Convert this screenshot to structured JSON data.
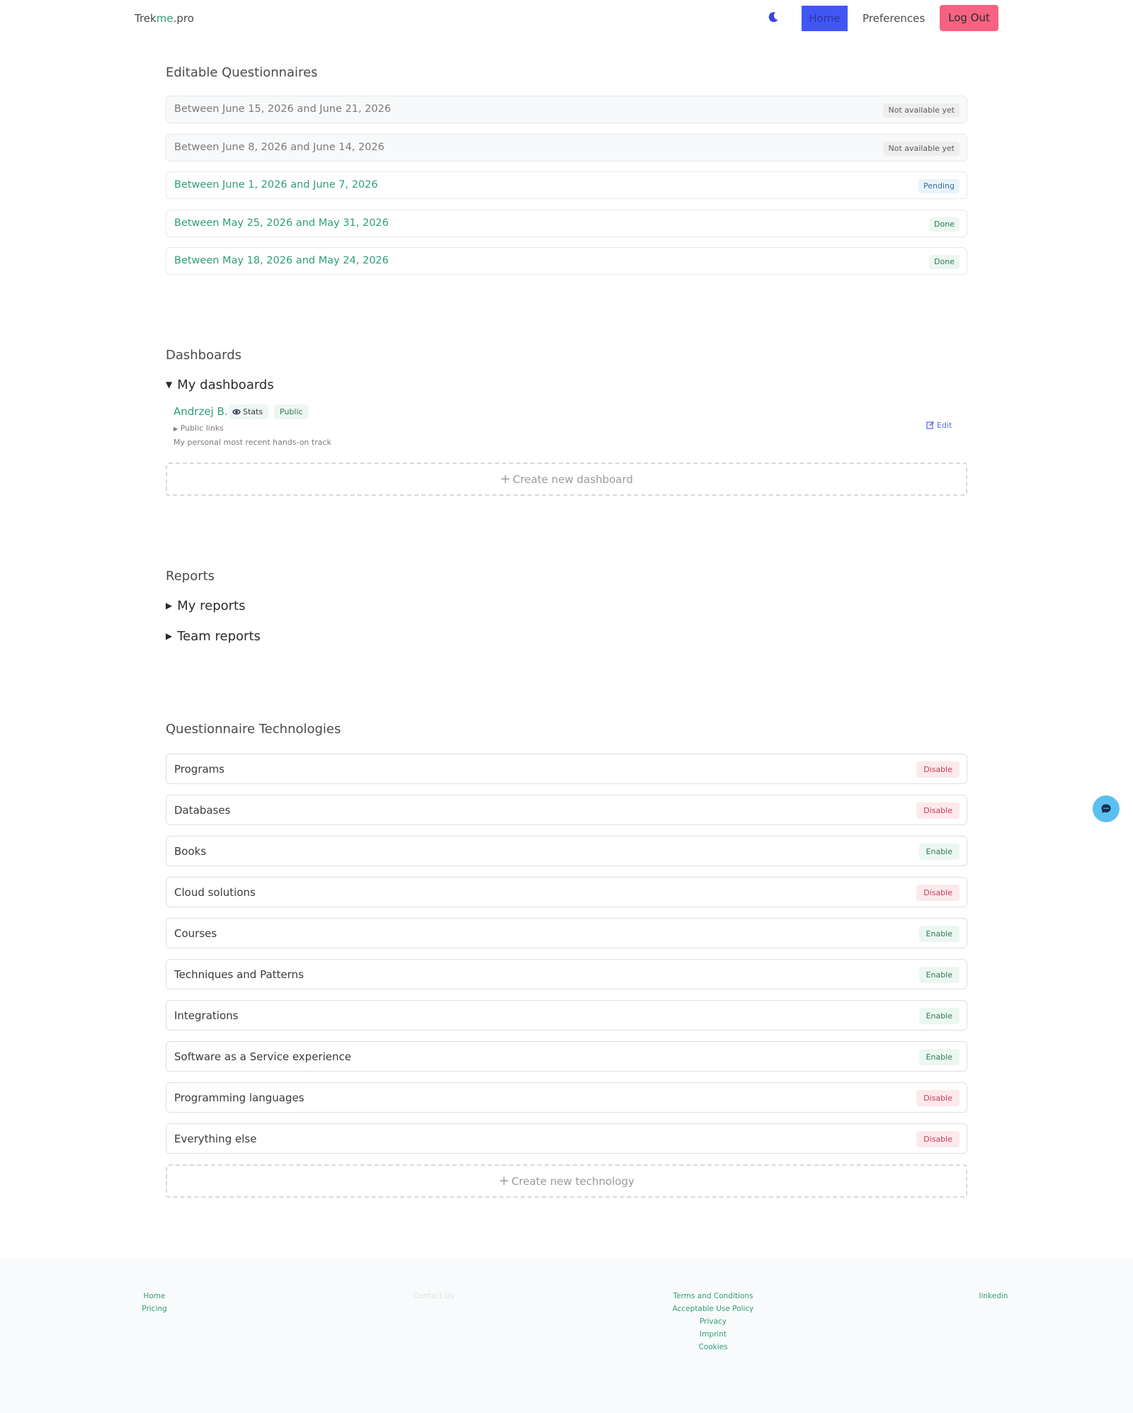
{
  "nav": {
    "brand_prefix": "Trek",
    "brand_accent": "me",
    "brand_suffix": ".pro",
    "theme_icon": "moon-icon",
    "home_label": "Home",
    "preferences_label": "Preferences",
    "logout_label": "Log Out",
    "colors": {
      "home_bg": "#4256f4",
      "logout_bg": "#f66382",
      "accent": "#2e9e79"
    }
  },
  "questionnaires": {
    "title": "Editable Questionnaires",
    "items": [
      {
        "label": "Between June 15, 2026 and June 21, 2026",
        "status": "Not available yet"
      },
      {
        "label": "Between June 8, 2026 and June 14, 2026",
        "status": "Not available yet"
      },
      {
        "label": "Between June 1, 2026 and June 7, 2026",
        "status": "Pending"
      },
      {
        "label": "Between May 25, 2026 and May 31, 2026",
        "status": "Done"
      },
      {
        "label": "Between May 18, 2026 and May 24, 2026",
        "status": "Done"
      }
    ]
  },
  "dashboards": {
    "title": "Dashboards",
    "my_dashboards_label": "My dashboards",
    "dashboard": {
      "owner": "Andrzej B.",
      "stats_tag": "Stats",
      "stats_icon": "eye-icon",
      "visibility_tag": "Public",
      "public_links_label": "Public links",
      "description": "My personal most recent hands-on track",
      "edit_label": "Edit",
      "edit_icon": "edit-icon"
    },
    "create_label": "Create new dashboard"
  },
  "reports": {
    "title": "Reports",
    "my_reports_label": "My reports",
    "team_reports_label": "Team reports"
  },
  "technologies": {
    "title": "Questionnaire Technologies",
    "items": [
      {
        "label": "Programs",
        "action": "Disable"
      },
      {
        "label": "Databases",
        "action": "Disable"
      },
      {
        "label": "Books",
        "action": "Enable"
      },
      {
        "label": "Cloud solutions",
        "action": "Disable"
      },
      {
        "label": "Courses",
        "action": "Enable"
      },
      {
        "label": "Techniques and Patterns",
        "action": "Enable"
      },
      {
        "label": "Integrations",
        "action": "Enable"
      },
      {
        "label": "Software as a Service experience",
        "action": "Enable"
      },
      {
        "label": "Programming languages",
        "action": "Disable"
      },
      {
        "label": "Everything else",
        "action": "Disable"
      }
    ],
    "create_label": "Create new technology"
  },
  "chat": {
    "icon": "chat-icon"
  },
  "footer": {
    "col1": [
      "Home",
      "Pricing"
    ],
    "col2": [
      "Contact Us"
    ],
    "col3": [
      "Terms and Conditions",
      "Acceptable Use Policy",
      "Privacy",
      "Imprint",
      "Cookies"
    ],
    "col4": [
      "linkedin"
    ]
  }
}
